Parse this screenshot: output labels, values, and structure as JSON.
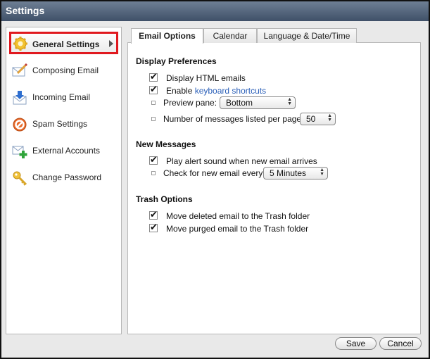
{
  "window": {
    "title": "Settings"
  },
  "sidebar": {
    "items": [
      {
        "label": "General Settings",
        "icon": "gear-icon"
      },
      {
        "label": "Composing Email",
        "icon": "compose-icon"
      },
      {
        "label": "Incoming Email",
        "icon": "incoming-mail-icon"
      },
      {
        "label": "Spam Settings",
        "icon": "spam-block-icon"
      },
      {
        "label": "External Accounts",
        "icon": "external-accounts-icon"
      },
      {
        "label": "Change Password",
        "icon": "key-icon"
      }
    ]
  },
  "tabs": [
    {
      "label": "Email Options"
    },
    {
      "label": "Calendar"
    },
    {
      "label": "Language & Date/Time"
    }
  ],
  "display_preferences": {
    "title": "Display Preferences",
    "display_html": {
      "label": "Display HTML emails",
      "checked": true
    },
    "keyboard_shortcuts": {
      "prefix": "Enable ",
      "link": "keyboard shortcuts",
      "checked": true
    },
    "preview_pane": {
      "label": "Preview pane:",
      "value": "Bottom"
    },
    "messages_per_page": {
      "label": "Number of messages listed per page:",
      "value": "50"
    }
  },
  "new_messages": {
    "title": "New Messages",
    "alert_sound": {
      "label": "Play alert sound when new email arrives",
      "checked": true
    },
    "check_every": {
      "label": "Check for new email every:",
      "value": "5 Minutes"
    }
  },
  "trash_options": {
    "title": "Trash Options",
    "move_deleted": {
      "label": "Move deleted email to the Trash folder",
      "checked": true
    },
    "move_purged": {
      "label": "Move purged email to the Trash folder",
      "checked": true
    }
  },
  "footer": {
    "save_label": "Save",
    "cancel_label": "Cancel"
  }
}
